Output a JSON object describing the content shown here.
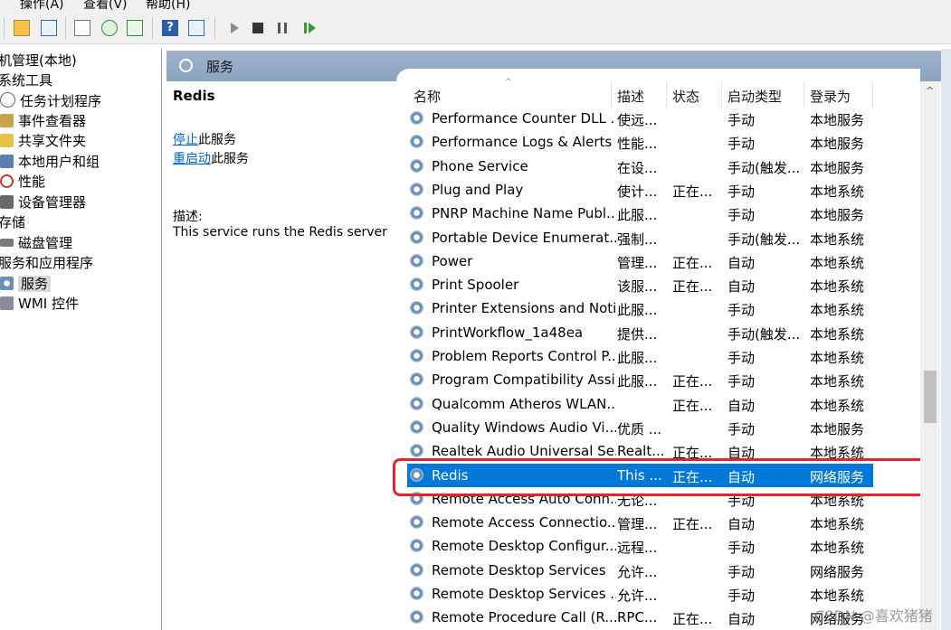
{
  "menu": [
    "操作(A)",
    "查看(V)",
    "帮助(H)"
  ],
  "tree": {
    "items": [
      {
        "label": "机管理(本地)",
        "icon": "computer-icon"
      },
      {
        "label": "系统工具",
        "icon": "tools-icon"
      },
      {
        "label": "任务计划程序",
        "icon": "clock-icon"
      },
      {
        "label": "事件查看器",
        "icon": "event-viewer-icon"
      },
      {
        "label": "共享文件夹",
        "icon": "shared-folder-icon"
      },
      {
        "label": "本地用户和组",
        "icon": "users-icon"
      },
      {
        "label": "性能",
        "icon": "performance-icon"
      },
      {
        "label": "设备管理器",
        "icon": "device-manager-icon"
      },
      {
        "label": "存储",
        "icon": "storage-icon"
      },
      {
        "label": "磁盘管理",
        "icon": "disk-icon"
      },
      {
        "label": "服务和应用程序",
        "icon": "services-apps-icon"
      },
      {
        "label": "服务",
        "icon": "services-icon"
      },
      {
        "label": "WMI 控件",
        "icon": "wmi-icon"
      }
    ]
  },
  "panel": {
    "title": "服务"
  },
  "detail": {
    "service_name": "Redis",
    "stop_link": "停止",
    "stop_suffix": "此服务",
    "restart_link": "重启动",
    "restart_suffix": "此服务",
    "description_label": "描述:",
    "description_text": "This service runs the Redis server"
  },
  "columns": [
    "名称",
    "描述",
    "状态",
    "启动类型",
    "登录为"
  ],
  "rows": [
    {
      "name": "Performance Counter DLL ...",
      "desc": "使远...",
      "status": "",
      "startup": "手动",
      "logon": "本地服务"
    },
    {
      "name": "Performance Logs & Alerts",
      "desc": "性能...",
      "status": "",
      "startup": "手动",
      "logon": "本地服务"
    },
    {
      "name": "Phone Service",
      "desc": "在设...",
      "status": "",
      "startup": "手动(触发...",
      "logon": "本地服务"
    },
    {
      "name": "Plug and Play",
      "desc": "使计...",
      "status": "正在...",
      "startup": "手动",
      "logon": "本地系统"
    },
    {
      "name": "PNRP Machine Name Publ...",
      "desc": "此服...",
      "status": "",
      "startup": "手动",
      "logon": "本地服务"
    },
    {
      "name": "Portable Device Enumerat...",
      "desc": "强制...",
      "status": "",
      "startup": "手动(触发...",
      "logon": "本地系统"
    },
    {
      "name": "Power",
      "desc": "管理...",
      "status": "正在...",
      "startup": "自动",
      "logon": "本地系统"
    },
    {
      "name": "Print Spooler",
      "desc": "该服...",
      "status": "正在...",
      "startup": "自动",
      "logon": "本地系统"
    },
    {
      "name": "Printer Extensions and Noti...",
      "desc": "此服...",
      "status": "",
      "startup": "手动",
      "logon": "本地系统"
    },
    {
      "name": "PrintWorkflow_1a48ea",
      "desc": "提供...",
      "status": "",
      "startup": "手动(触发...",
      "logon": "本地系统"
    },
    {
      "name": "Problem Reports Control P...",
      "desc": "此服...",
      "status": "",
      "startup": "手动",
      "logon": "本地系统"
    },
    {
      "name": "Program Compatibility Assi...",
      "desc": "此服...",
      "status": "正在...",
      "startup": "手动",
      "logon": "本地系统"
    },
    {
      "name": "Qualcomm Atheros WLAN...",
      "desc": "",
      "status": "正在...",
      "startup": "自动",
      "logon": "本地系统"
    },
    {
      "name": "Quality Windows Audio Vi...",
      "desc": "优质 ...",
      "status": "",
      "startup": "手动",
      "logon": "本地服务"
    },
    {
      "name": "Realtek Audio Universal Se...",
      "desc": "Realt...",
      "status": "正在...",
      "startup": "自动",
      "logon": "本地系统"
    },
    {
      "name": "Redis",
      "desc": "This ...",
      "status": "正在...",
      "startup": "自动",
      "logon": "网络服务",
      "selected": true
    },
    {
      "name": "Remote Access Auto Conn...",
      "desc": "无论...",
      "status": "",
      "startup": "手动",
      "logon": "本地系统"
    },
    {
      "name": "Remote Access Connectio...",
      "desc": "管理...",
      "status": "正在...",
      "startup": "自动",
      "logon": "本地系统"
    },
    {
      "name": "Remote Desktop Configur...",
      "desc": "远程...",
      "status": "",
      "startup": "手动",
      "logon": "本地系统"
    },
    {
      "name": "Remote Desktop Services",
      "desc": "允许...",
      "status": "",
      "startup": "手动",
      "logon": "网络服务"
    },
    {
      "name": "Remote Desktop Services ...",
      "desc": "允许...",
      "status": "",
      "startup": "手动",
      "logon": "本地系统"
    },
    {
      "name": "Remote Procedure Call (R...",
      "desc": "RPC...",
      "status": "正在...",
      "startup": "自动",
      "logon": "网络服务"
    }
  ],
  "watermark": "CSDN @喜欢猪猪",
  "colors": {
    "selection": "#0078d7",
    "highlight_box": "#e5232b",
    "link": "#0066cc",
    "header": "#8aa3c0"
  }
}
